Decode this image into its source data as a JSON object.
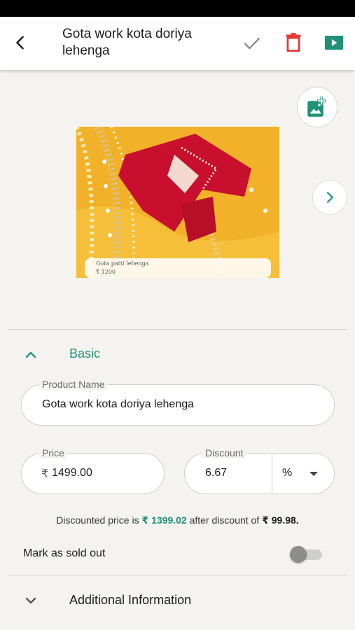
{
  "header": {
    "title": "Gota work kota doriya lehenga",
    "icons": [
      "back-arrow-icon",
      "check-icon",
      "delete-icon",
      "video-icon"
    ],
    "colors": {
      "check": "#8a8a8a",
      "delete": "#e53935",
      "video": "#1f9178"
    }
  },
  "gallery": {
    "caption_title": "Gota patti lehenga",
    "caption_price": "₹ 1200",
    "icons": [
      "add-photo-icon",
      "chevron-right-icon"
    ]
  },
  "basic": {
    "section_label": "Basic",
    "product_name": {
      "label": "Product Name",
      "value": "Gota work kota doriya lehenga"
    },
    "price": {
      "label": "Price",
      "currency": "₹",
      "value": "1499.00"
    },
    "discount": {
      "label": "Discount",
      "value": "6.67",
      "unit": "%"
    },
    "discount_summary": {
      "prefix": "Discounted price is",
      "discounted_price": "₹ 1399.02",
      "middle": "after discount of",
      "discount_amount": "₹ 99.98."
    },
    "sold_out": {
      "label": "Mark as sold out",
      "enabled": false
    }
  },
  "additional": {
    "section_label": "Additional Information"
  },
  "accent_color": "#1f9178"
}
